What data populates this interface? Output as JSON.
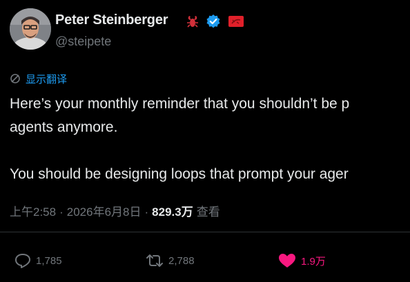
{
  "author": {
    "name": "Peter Steinberger",
    "handle": "@steipete",
    "avatar_icon": "person-avatar",
    "badges": [
      "lobster-emoji-icon",
      "verified-badge-icon",
      "red-flag-icon"
    ]
  },
  "translate": {
    "label": "显示翻译",
    "icon": "translate-icon"
  },
  "tweet": {
    "line1": "Here’s your monthly reminder that you shouldn’t be p",
    "line2": "agents anymore.",
    "line3": "You should be designing loops that prompt your ager"
  },
  "meta": {
    "time": "上午2:58",
    "sep1": "·",
    "date": "2026年6月8日",
    "sep2": "·",
    "views_count": "829.3万",
    "views_label": "查看"
  },
  "actions": {
    "reply_count": "1,785",
    "repost_count": "2,788",
    "like_count": "1.9万"
  },
  "colors": {
    "background": "#000000",
    "text": "#e7e9ea",
    "secondary": "#71767b",
    "accent": "#1d9bf0",
    "like": "#f91880"
  }
}
